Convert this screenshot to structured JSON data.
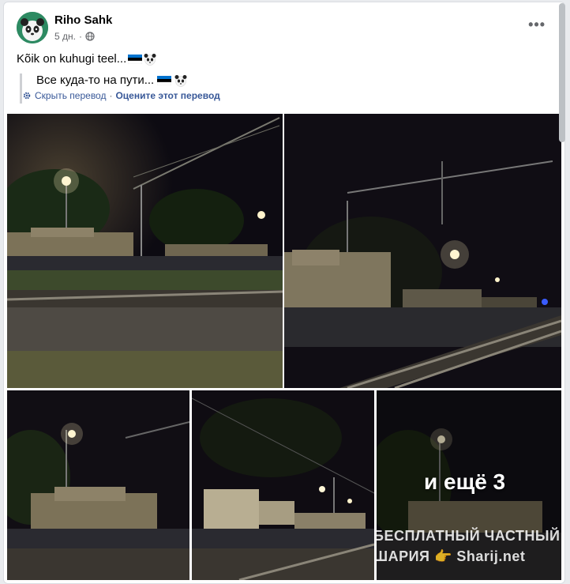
{
  "post": {
    "author": "Riho Sahk",
    "time": "5 дн.",
    "privacy_icon": "globe-icon",
    "menu_icon": "more-horizontal-icon",
    "text": "Kõik on kuhugi teel...",
    "translation": {
      "text": "Все куда-то на пути...",
      "hide_label": "Скрыть перевод",
      "separator": "·",
      "rate_label": "Оцените этот перевод"
    },
    "emoji": [
      "estonia-flag",
      "panda-face"
    ]
  },
  "gallery": {
    "more_label": "и ещё 3",
    "watermark_line1": "БЕСПЛАТНЫЙ ЧАСТНЫЙ",
    "watermark_line2": "ШАРИЯ 👉 Sharij.net"
  },
  "colors": {
    "link": "#385898",
    "muted": "#65676b",
    "text": "#050505",
    "card_bg": "#ffffff",
    "page_bg": "#e9ebee"
  }
}
